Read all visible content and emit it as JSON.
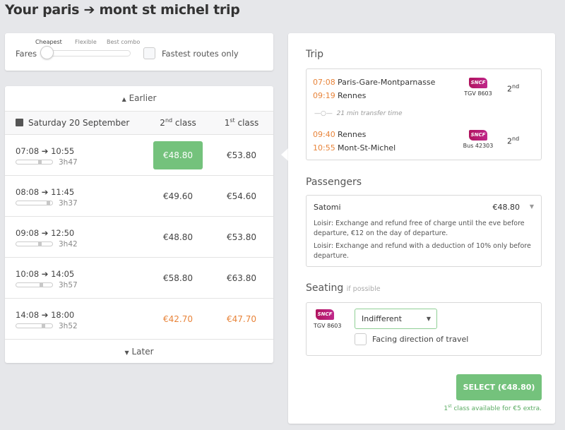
{
  "title": "Your paris ➔ mont st michel trip",
  "filters": {
    "fares_label": "Fares",
    "slider_options": [
      "Cheapest",
      "Flexible",
      "Best combo"
    ],
    "slider_selected": "Cheapest",
    "fastest_label": "Fastest routes only",
    "fastest_checked": false
  },
  "results": {
    "earlier": "Earlier",
    "later": "Later",
    "date": "Saturday 20 September",
    "col2": "2",
    "col2_sup": "nd",
    "col2_suffix": " class",
    "col1": "1",
    "col1_sup": "st",
    "col1_suffix": " class",
    "rows": [
      {
        "dep": "07:08",
        "arr": "10:55",
        "duration": "3h47",
        "second": "€48.80",
        "first": "€53.80",
        "selected": true,
        "highlight": false
      },
      {
        "dep": "08:08",
        "arr": "11:45",
        "duration": "3h37",
        "second": "€49.60",
        "first": "€54.60",
        "selected": false,
        "highlight": false
      },
      {
        "dep": "09:08",
        "arr": "12:50",
        "duration": "3h42",
        "second": "€48.80",
        "first": "€53.80",
        "selected": false,
        "highlight": false
      },
      {
        "dep": "10:08",
        "arr": "14:05",
        "duration": "3h57",
        "second": "€58.80",
        "first": "€63.80",
        "selected": false,
        "highlight": false
      },
      {
        "dep": "14:08",
        "arr": "18:00",
        "duration": "3h52",
        "second": "€42.70",
        "first": "€47.70",
        "selected": false,
        "highlight": true
      }
    ]
  },
  "trip": {
    "heading": "Trip",
    "legs": [
      {
        "dep_time": "07:08",
        "dep_station": "Paris-Gare-Montparnasse",
        "arr_time": "09:19",
        "arr_station": "Rennes",
        "operator": "SNCF",
        "service": "TGV 8603",
        "class": "2",
        "class_sup": "nd"
      },
      {
        "dep_time": "09:40",
        "dep_station": "Rennes",
        "arr_time": "10:55",
        "arr_station": "Mont-St-Michel",
        "operator": "SNCF",
        "service": "Bus 42303",
        "class": "2",
        "class_sup": "nd"
      }
    ],
    "transfer": "21 min transfer time"
  },
  "passengers": {
    "heading": "Passengers",
    "name": "Satomi",
    "price": "€48.80",
    "conditions": [
      "Loisir: Exchange and refund free of charge until the eve before departure, €12 on the day of departure.",
      "Loisir: Exchange and refund with a deduction of 10% only before departure."
    ]
  },
  "seating": {
    "heading": "Seating",
    "hint": "if possible",
    "operator": "SNCF",
    "service": "TGV 8603",
    "select_value": "Indifferent",
    "facing_label": "Facing direction of travel",
    "facing_checked": false
  },
  "select_button": "SELECT (€48.80)",
  "upsell": {
    "sup_base": "1",
    "sup": "st",
    "text": " class available for €5 extra."
  },
  "colors": {
    "green": "#74c27c",
    "orange": "#e8843a",
    "sncf": "#b0135e"
  }
}
